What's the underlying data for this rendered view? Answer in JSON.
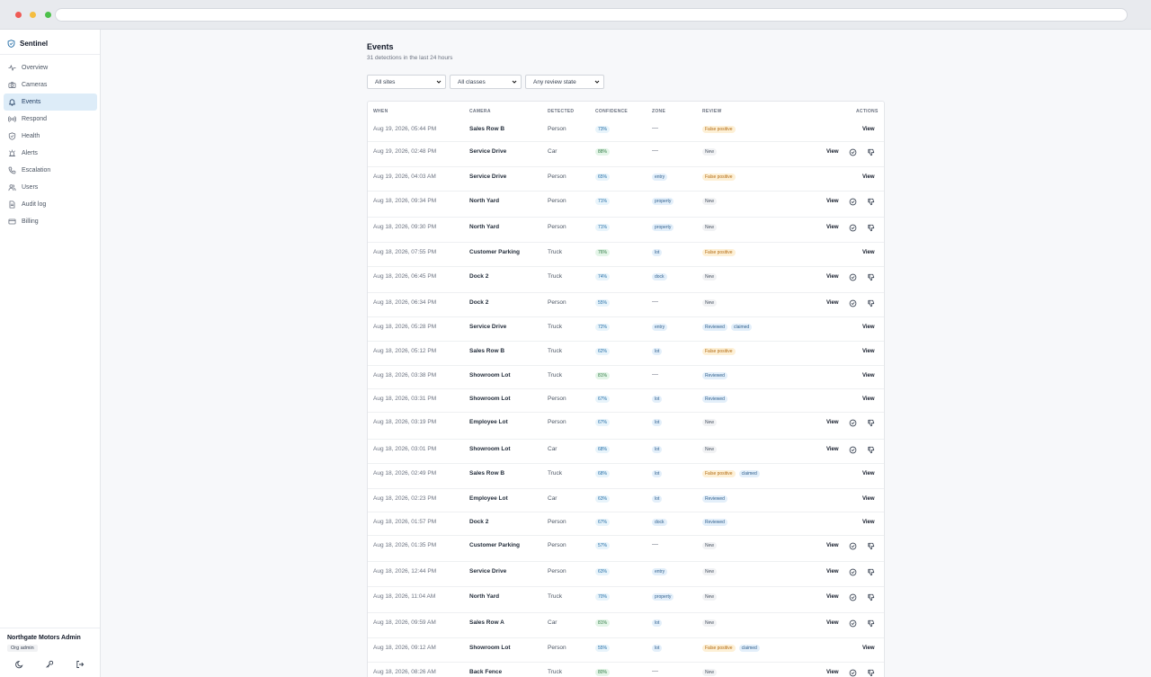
{
  "app": {
    "name": "Sentinel"
  },
  "sidebar": {
    "items": [
      {
        "label": "Overview",
        "icon": "activity-icon",
        "active": false
      },
      {
        "label": "Cameras",
        "icon": "camera-icon",
        "active": false
      },
      {
        "label": "Events",
        "icon": "bell-icon",
        "active": true
      },
      {
        "label": "Respond",
        "icon": "broadcast-icon",
        "active": false
      },
      {
        "label": "Health",
        "icon": "shield-check-icon",
        "active": false
      },
      {
        "label": "Alerts",
        "icon": "siren-icon",
        "active": false
      },
      {
        "label": "Escalation",
        "icon": "phone-icon",
        "active": false
      },
      {
        "label": "Users",
        "icon": "users-icon",
        "active": false
      },
      {
        "label": "Audit log",
        "icon": "document-icon",
        "active": false
      },
      {
        "label": "Billing",
        "icon": "credit-card-icon",
        "active": false
      }
    ],
    "user": {
      "org": "Northgate Motors Admin",
      "role": "Org admin"
    },
    "footer_icons": [
      "theme-moon-icon",
      "key-icon",
      "logout-icon"
    ]
  },
  "page": {
    "title": "Events",
    "subtitle": "31 detections in the last 24 hours"
  },
  "filters": {
    "site": "All sites",
    "class": "All classes",
    "review": "Any review state"
  },
  "table": {
    "columns": {
      "when": "WHEN",
      "camera": "CAMERA",
      "detected": "DETECTED",
      "confidence": "CONFIDENCE",
      "zone": "ZONE",
      "review": "REVIEW",
      "actions": "ACTIONS"
    },
    "view_label": "View",
    "rows": [
      {
        "when": "Aug 19, 2026, 05:44 PM",
        "camera": "Sales Row B",
        "detected": "Person",
        "confidence": "73%",
        "zone": "—",
        "review": [
          "False positive"
        ]
      },
      {
        "when": "Aug 19, 2026, 02:48 PM",
        "camera": "Service Drive",
        "detected": "Car",
        "confidence": "88%",
        "zone": "—",
        "review": [
          "New"
        ]
      },
      {
        "when": "Aug 19, 2026, 04:03 AM",
        "camera": "Service Drive",
        "detected": "Person",
        "confidence": "65%",
        "zone": "entry",
        "review": [
          "False positive"
        ]
      },
      {
        "when": "Aug 18, 2026, 09:34 PM",
        "camera": "North Yard",
        "detected": "Person",
        "confidence": "71%",
        "zone": "property",
        "review": [
          "New"
        ]
      },
      {
        "when": "Aug 18, 2026, 09:30 PM",
        "camera": "North Yard",
        "detected": "Person",
        "confidence": "71%",
        "zone": "property",
        "review": [
          "New"
        ]
      },
      {
        "when": "Aug 18, 2026, 07:55 PM",
        "camera": "Customer Parking",
        "detected": "Truck",
        "confidence": "76%",
        "zone": "lot",
        "review": [
          "False positive"
        ]
      },
      {
        "when": "Aug 18, 2026, 06:45 PM",
        "camera": "Dock 2",
        "detected": "Truck",
        "confidence": "74%",
        "zone": "dock",
        "review": [
          "New"
        ]
      },
      {
        "when": "Aug 18, 2026, 06:34 PM",
        "camera": "Dock 2",
        "detected": "Person",
        "confidence": "55%",
        "zone": "—",
        "review": [
          "New"
        ]
      },
      {
        "when": "Aug 18, 2026, 05:28 PM",
        "camera": "Service Drive",
        "detected": "Truck",
        "confidence": "72%",
        "zone": "entry",
        "review": [
          "Reviewed",
          "claimed"
        ]
      },
      {
        "when": "Aug 18, 2026, 05:12 PM",
        "camera": "Sales Row B",
        "detected": "Truck",
        "confidence": "62%",
        "zone": "lot",
        "review": [
          "False positive"
        ]
      },
      {
        "when": "Aug 18, 2026, 03:38 PM",
        "camera": "Showroom Lot",
        "detected": "Truck",
        "confidence": "81%",
        "zone": "—",
        "review": [
          "Reviewed"
        ]
      },
      {
        "when": "Aug 18, 2026, 03:31 PM",
        "camera": "Showroom Lot",
        "detected": "Person",
        "confidence": "67%",
        "zone": "lot",
        "review": [
          "Reviewed"
        ]
      },
      {
        "when": "Aug 18, 2026, 03:19 PM",
        "camera": "Employee Lot",
        "detected": "Person",
        "confidence": "67%",
        "zone": "lot",
        "review": [
          "New"
        ]
      },
      {
        "when": "Aug 18, 2026, 03:01 PM",
        "camera": "Showroom Lot",
        "detected": "Car",
        "confidence": "68%",
        "zone": "lot",
        "review": [
          "New"
        ]
      },
      {
        "when": "Aug 18, 2026, 02:49 PM",
        "camera": "Sales Row B",
        "detected": "Truck",
        "confidence": "68%",
        "zone": "lot",
        "review": [
          "False positive",
          "claimed"
        ]
      },
      {
        "when": "Aug 18, 2026, 02:23 PM",
        "camera": "Employee Lot",
        "detected": "Car",
        "confidence": "63%",
        "zone": "lot",
        "review": [
          "Reviewed"
        ]
      },
      {
        "when": "Aug 18, 2026, 01:57 PM",
        "camera": "Dock 2",
        "detected": "Person",
        "confidence": "67%",
        "zone": "dock",
        "review": [
          "Reviewed"
        ]
      },
      {
        "when": "Aug 18, 2026, 01:35 PM",
        "camera": "Customer Parking",
        "detected": "Person",
        "confidence": "57%",
        "zone": "—",
        "review": [
          "New"
        ]
      },
      {
        "when": "Aug 18, 2026, 12:44 PM",
        "camera": "Service Drive",
        "detected": "Person",
        "confidence": "63%",
        "zone": "entry",
        "review": [
          "New"
        ]
      },
      {
        "when": "Aug 18, 2026, 11:04 AM",
        "camera": "North Yard",
        "detected": "Truck",
        "confidence": "70%",
        "zone": "property",
        "review": [
          "New"
        ]
      },
      {
        "when": "Aug 18, 2026, 09:59 AM",
        "camera": "Sales Row A",
        "detected": "Car",
        "confidence": "81%",
        "zone": "lot",
        "review": [
          "New"
        ]
      },
      {
        "when": "Aug 18, 2026, 09:12 AM",
        "camera": "Showroom Lot",
        "detected": "Person",
        "confidence": "55%",
        "zone": "lot",
        "review": [
          "False positive",
          "claimed"
        ]
      },
      {
        "when": "Aug 18, 2026, 08:26 AM",
        "camera": "Back Fence",
        "detected": "Truck",
        "confidence": "80%",
        "zone": "—",
        "review": [
          "New"
        ]
      }
    ]
  },
  "colors": {
    "accent": "#1f6aa5",
    "active_nav_bg": "#ddecf8",
    "false_positive": "#b36b12",
    "confidence_high": "#2f7a43"
  }
}
